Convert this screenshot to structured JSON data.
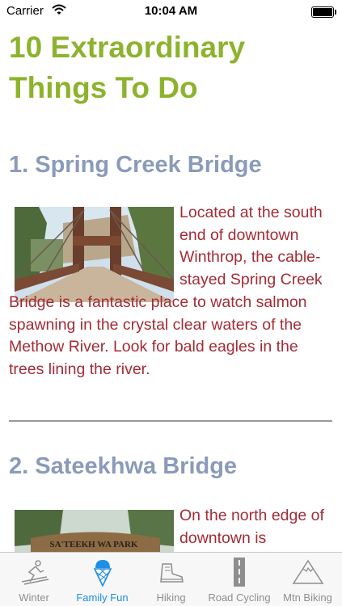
{
  "status_bar": {
    "carrier": "Carrier",
    "time": "10:04 AM"
  },
  "page": {
    "title": "10 Extraordinary Things To Do"
  },
  "items": [
    {
      "heading": "1. Spring Creek Bridge",
      "text": "Located at the south end of downtown Winthrop, the cable-stayed Spring Creek Bridge is a fantastic place to watch salmon spawning in the crystal clear waters of the Methow River. Look for bald eagles in the trees lining the river.",
      "photo_name": "spring-creek-bridge-photo"
    },
    {
      "heading": "2. Sateekhwa Bridge",
      "text": "On the north edge of downtown is",
      "photo_name": "sateekhwa-park-photo",
      "sign_text": "SA'TEEKH WA PARK"
    }
  ],
  "tab_bar": {
    "tabs": [
      {
        "label": "Winter",
        "icon": "skier-icon",
        "active": false
      },
      {
        "label": "Family Fun",
        "icon": "ice-cream-icon",
        "active": true
      },
      {
        "label": "Hiking",
        "icon": "hiking-boot-icon",
        "active": false
      },
      {
        "label": "Road Cycling",
        "icon": "road-icon",
        "active": false
      },
      {
        "label": "Mtn Biking",
        "icon": "mountain-icon",
        "active": false
      }
    ]
  },
  "colors": {
    "title": "#8db32e",
    "heading": "#8a9bb9",
    "body_text": "#a32c36",
    "active_tab": "#1e8ee6",
    "inactive_tab": "#8e8e8e"
  }
}
